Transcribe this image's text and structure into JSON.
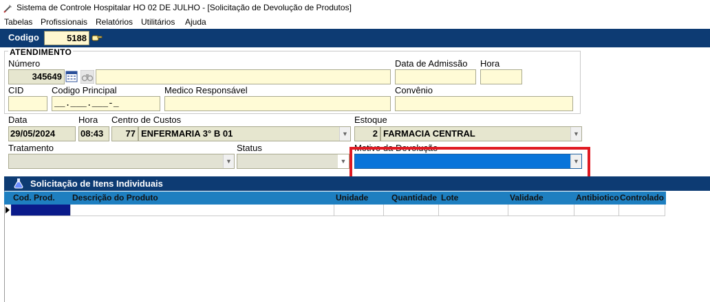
{
  "window": {
    "title": "Sistema de Controle Hospitalar HO 02 DE JULHO - [Solicitação de Devolução de Produtos]"
  },
  "menu": [
    "Tabelas",
    "Profissionais",
    "Relatórios",
    "Utilitários",
    "Ajuda"
  ],
  "code": {
    "label": "Codigo",
    "value": "5188"
  },
  "atendimento": {
    "title": "ATENDIMENTO",
    "numero_label": "Número",
    "numero_value": "345649",
    "data_admissao_label": "Data de Admissão",
    "hora_label": "Hora",
    "cid_label": "CID",
    "codigo_principal_label": "Codigo Principal",
    "codigo_principal_mask": "__.___.___-_",
    "medico_label": "Medico Responsável",
    "convenio_label": "Convênio"
  },
  "form": {
    "data_label": "Data",
    "data_value": "29/05/2024",
    "hora_label": "Hora",
    "hora_value": "08:43",
    "centro_label": "Centro de Custos",
    "centro_code": "77",
    "centro_name": "ENFERMARIA 3° B 01",
    "estoque_label": "Estoque",
    "estoque_code": "2",
    "estoque_name": "FARMACIA CENTRAL",
    "tratamento_label": "Tratamento",
    "status_label": "Status",
    "motivo_label": "Motivo da Devolução"
  },
  "items": {
    "title": "Solicitação de Itens Individuais",
    "columns": [
      "Cod. Prod.",
      "Descrição do Produto",
      "Unidade",
      "Quantidade",
      "Lote",
      "Validade",
      "Antibiotico",
      "Controlado"
    ]
  },
  "colors": {
    "header_bg": "#0d3b73",
    "grid_header": "#1e7fc0",
    "field_bg": "#fffbd6",
    "highlight": "#e01a22",
    "selected": "#0a74d9"
  }
}
